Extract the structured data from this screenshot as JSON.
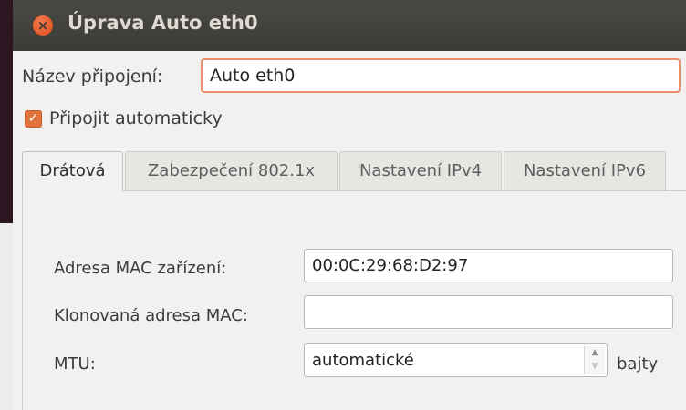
{
  "window": {
    "title": "Úprava Auto eth0",
    "close_symbol": "×"
  },
  "connection_name": {
    "label": "Název připojení:",
    "value": "Auto eth0"
  },
  "auto_connect": {
    "label": "Připojit automaticky",
    "checked": true,
    "check_symbol": "✓"
  },
  "tabs": [
    {
      "label": "Drátová",
      "active": true
    },
    {
      "label": "Zabezpečení 802.1x",
      "active": false
    },
    {
      "label": "Nastavení IPv4",
      "active": false
    },
    {
      "label": "Nastavení IPv6",
      "active": false
    }
  ],
  "wired": {
    "mac_label": "Adresa MAC zařízení:",
    "mac_value": "00:0C:29:68:D2:97",
    "cloned_mac_label": "Klonovaná adresa MAC:",
    "cloned_mac_value": "",
    "mtu_label": "MTU:",
    "mtu_value": "automatické",
    "mtu_unit": "bajty",
    "spin_up": "▲",
    "spin_down": "▼"
  },
  "colors": {
    "accent": "#e2733f",
    "titlebar": "#3c3b37",
    "focus_border": "#e98f69"
  }
}
